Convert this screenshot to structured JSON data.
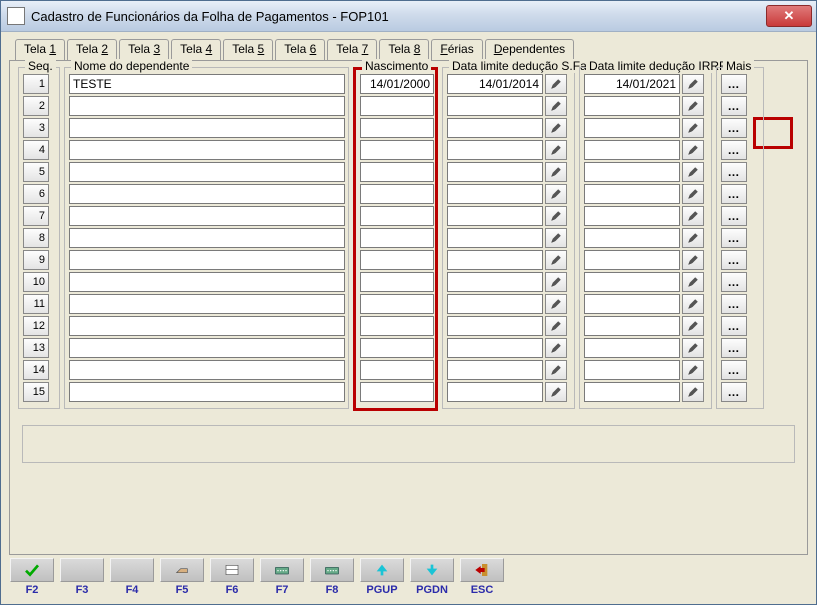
{
  "window": {
    "title": "Cadastro de Funcionários da Folha de Pagamentos - FOP101"
  },
  "tabs": [
    "Tela 1",
    "Tela 2",
    "Tela 3",
    "Tela 4",
    "Tela 5",
    "Tela 6",
    "Tela 7",
    "Tela 8",
    "Férias",
    "Dependentes"
  ],
  "active_tab": 9,
  "headers": {
    "seq": "Seq.",
    "nome": "Nome do dependente",
    "nascimento": "Nascimento",
    "familia": "Data limite dedução S.Família",
    "irrf": "Data limite dedução IRRF",
    "mais": "Mais"
  },
  "rows": [
    {
      "seq": "1",
      "nome": "TESTE",
      "nascimento": "14/01/2000",
      "familia": "14/01/2014",
      "irrf": "14/01/2021"
    },
    {
      "seq": "2",
      "nome": "",
      "nascimento": "",
      "familia": "",
      "irrf": ""
    },
    {
      "seq": "3",
      "nome": "",
      "nascimento": "",
      "familia": "",
      "irrf": ""
    },
    {
      "seq": "4",
      "nome": "",
      "nascimento": "",
      "familia": "",
      "irrf": ""
    },
    {
      "seq": "5",
      "nome": "",
      "nascimento": "",
      "familia": "",
      "irrf": ""
    },
    {
      "seq": "6",
      "nome": "",
      "nascimento": "",
      "familia": "",
      "irrf": ""
    },
    {
      "seq": "7",
      "nome": "",
      "nascimento": "",
      "familia": "",
      "irrf": ""
    },
    {
      "seq": "8",
      "nome": "",
      "nascimento": "",
      "familia": "",
      "irrf": ""
    },
    {
      "seq": "9",
      "nome": "",
      "nascimento": "",
      "familia": "",
      "irrf": ""
    },
    {
      "seq": "10",
      "nome": "",
      "nascimento": "",
      "familia": "",
      "irrf": ""
    },
    {
      "seq": "11",
      "nome": "",
      "nascimento": "",
      "familia": "",
      "irrf": ""
    },
    {
      "seq": "12",
      "nome": "",
      "nascimento": "",
      "familia": "",
      "irrf": ""
    },
    {
      "seq": "13",
      "nome": "",
      "nascimento": "",
      "familia": "",
      "irrf": ""
    },
    {
      "seq": "14",
      "nome": "",
      "nascimento": "",
      "familia": "",
      "irrf": ""
    },
    {
      "seq": "15",
      "nome": "",
      "nascimento": "",
      "familia": "",
      "irrf": ""
    }
  ],
  "toolbar": [
    {
      "key": "F2",
      "icon": "check"
    },
    {
      "key": "F3",
      "icon": "blank"
    },
    {
      "key": "F4",
      "icon": "blank"
    },
    {
      "key": "F5",
      "icon": "hand"
    },
    {
      "key": "F6",
      "icon": "layout"
    },
    {
      "key": "F7",
      "icon": "kbd"
    },
    {
      "key": "F8",
      "icon": "kbd"
    },
    {
      "key": "PGUP",
      "icon": "up"
    },
    {
      "key": "PGDN",
      "icon": "down"
    },
    {
      "key": "ESC",
      "icon": "exit"
    }
  ]
}
